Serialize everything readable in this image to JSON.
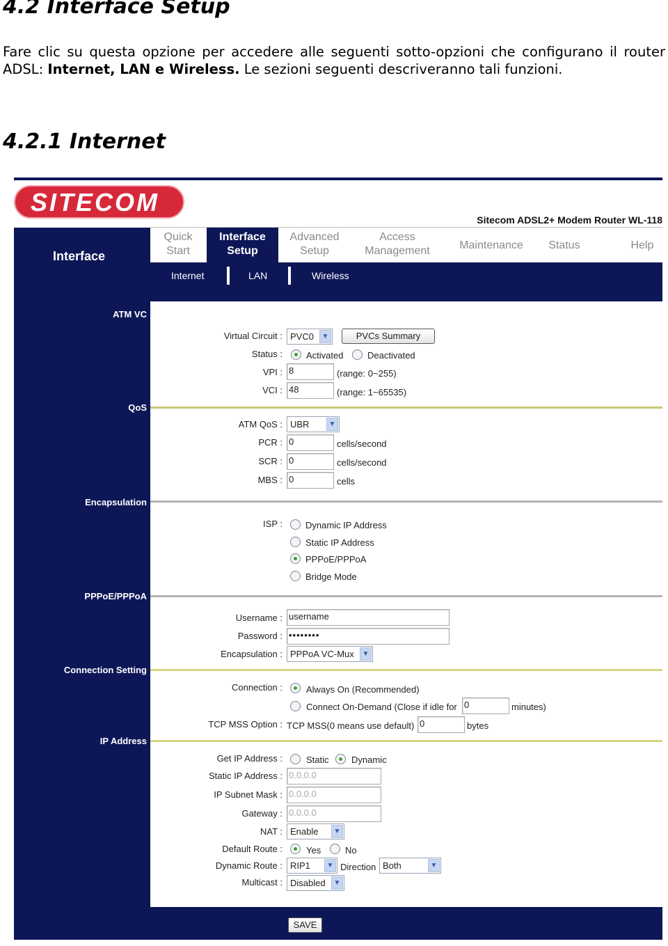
{
  "doc": {
    "heading1": "4.2 Interface Setup",
    "para_a": "Fare clic su questa opzione per accedere alle seguenti sotto-opzioni che configurano il router ADSL: ",
    "para_bold": "Internet, LAN e Wireless.",
    "para_b": " Le sezioni seguenti descriveranno tali funzioni.",
    "heading2": "4.2.1 Internet"
  },
  "ui": {
    "logo_text": "SITECOM",
    "model": "Sitecom ADSL2+ Modem Router WL-118",
    "side_title": "Interface",
    "tabs": [
      {
        "l1": "Quick",
        "l2": "Start"
      },
      {
        "l1": "Interface",
        "l2": "Setup"
      },
      {
        "l1": "Advanced",
        "l2": "Setup"
      },
      {
        "l1": "Access",
        "l2": "Management"
      },
      {
        "l1": "Maintenance"
      },
      {
        "l1": "Status"
      },
      {
        "l1": "Help"
      }
    ],
    "subtabs": [
      "Internet",
      "LAN",
      "Wireless"
    ],
    "sections": [
      "ATM VC",
      "QoS",
      "Encapsulation",
      "PPPoE/PPPoA",
      "Connection Setting",
      "IP Address"
    ],
    "atm": {
      "vc_label": "Virtual Circuit :",
      "vc_value": "PVC0",
      "pvc_button": "PVCs Summary",
      "status_label": "Status :",
      "activated": "Activated",
      "deactivated": "Deactivated",
      "status_selected": "Activated",
      "vpi_label": "VPI :",
      "vpi": "8",
      "vpi_range": "(range: 0~255)",
      "vci_label": "VCI :",
      "vci": "48",
      "vci_range": "(range: 1~65535)"
    },
    "qos": {
      "label": "ATM QoS :",
      "value": "UBR",
      "pcr_label": "PCR :",
      "pcr": "0",
      "scr_label": "SCR :",
      "scr": "0",
      "mbs_label": "MBS :",
      "mbs": "0",
      "unit_cps": "cells/second",
      "unit_cells": "cells"
    },
    "encap": {
      "isp_label": "ISP :",
      "options": [
        "Dynamic IP Address",
        "Static IP Address",
        "PPPoE/PPPoA",
        "Bridge Mode"
      ],
      "selected": "PPPoE/PPPoA"
    },
    "ppp": {
      "user_label": "Username :",
      "user": "username",
      "pass_label": "Password :",
      "pass": "••••••••",
      "enc_label": "Encapsulation :",
      "enc": "PPPoA VC-Mux"
    },
    "conn": {
      "label": "Connection :",
      "always": "Always On (Recommended)",
      "demand": "Connect On-Demand (Close if idle for",
      "idle": "0",
      "minutes": "minutes)",
      "mss_label": "TCP MSS Option :",
      "mss_text": "TCP MSS(0 means use default)",
      "mss": "0",
      "bytes": "bytes"
    },
    "ip": {
      "get_label": "Get IP Address :",
      "static": "Static",
      "dynamic": "Dynamic",
      "sip_label": "Static IP Address :",
      "sip": "0.0.0.0",
      "mask_label": "IP Subnet Mask :",
      "mask": "0.0.0.0",
      "gw_label": "Gateway :",
      "gw": "0.0.0.0",
      "nat_label": "NAT :",
      "nat": "Enable",
      "dr_label": "Default Route :",
      "yes": "Yes",
      "no": "No",
      "dyn_label": "Dynamic Route :",
      "dyn": "RIP1",
      "dir_label": "Direction",
      "dir": "Both",
      "mc_label": "Multicast :",
      "mc": "Disabled"
    },
    "save": "SAVE",
    "colors": {
      "navy": "#0d1757",
      "logo_red": "#d7283a",
      "sep_olive": "#c8c878",
      "sep_gray": "#b4b4b4"
    }
  }
}
